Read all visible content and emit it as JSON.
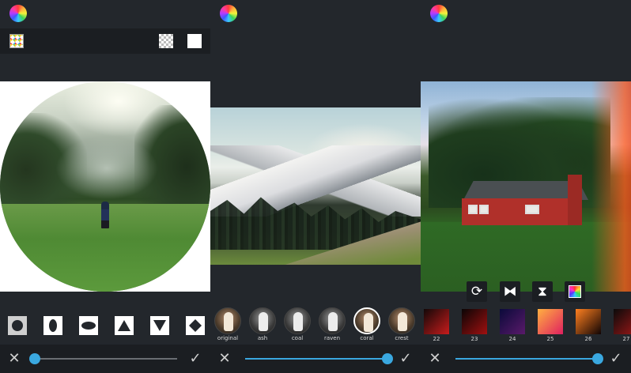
{
  "panels": [
    {
      "id": "shapes",
      "slider_value": 0,
      "shapes": [
        "circle",
        "ellipse-vertical",
        "ellipse-horizontal",
        "triangle-up",
        "triangle-down",
        "diamond"
      ],
      "selected_shape": "circle"
    },
    {
      "id": "filters",
      "slider_value": 1,
      "filters": [
        {
          "label": "original",
          "style": "color"
        },
        {
          "label": "ash",
          "style": "bw"
        },
        {
          "label": "coal",
          "style": "bw"
        },
        {
          "label": "raven",
          "style": "bw"
        },
        {
          "label": "coral",
          "style": "color",
          "selected": true
        },
        {
          "label": "crest",
          "style": "color"
        }
      ]
    },
    {
      "id": "overlays",
      "slider_value": 1,
      "overlays": [
        {
          "label": "22",
          "colors": [
            "#120808",
            "#c81c1c"
          ]
        },
        {
          "label": "23",
          "colors": [
            "#0a0505",
            "#a01010"
          ]
        },
        {
          "label": "24",
          "colors": [
            "#0a0a3a",
            "#5a1a6a"
          ]
        },
        {
          "label": "25",
          "colors": [
            "#ffb040",
            "#e02060"
          ]
        },
        {
          "label": "26",
          "colors": [
            "#ff8020",
            "#100404"
          ]
        },
        {
          "label": "27",
          "colors": [
            "#0a0a0a",
            "#a01818"
          ]
        }
      ]
    }
  ],
  "colors": {
    "accent": "#3aa8e0",
    "background": "#23272c",
    "bar": "#1b1e22"
  },
  "icons": {
    "close": "✕",
    "confirm": "✓",
    "rotate": "⟳",
    "flip_horizontal": "⧓",
    "flip_vertical": "⧗",
    "color_picker": "▦"
  }
}
